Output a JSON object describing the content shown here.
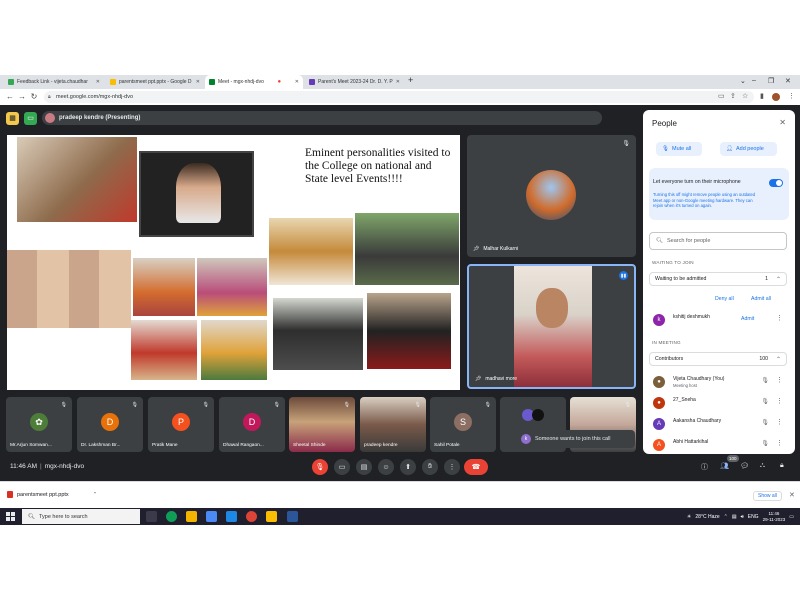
{
  "browser": {
    "tabs": [
      {
        "title": "Feedback Link - vijeta.chaudhar",
        "active": false
      },
      {
        "title": "parentsmeet ppt.pptx - Google D",
        "active": false
      },
      {
        "title": "Meet - mgx-nhdj-dvo",
        "active": true
      },
      {
        "title": "Parent's Meet 2023-24 Dr. D. Y. P",
        "active": false
      }
    ],
    "url": "meet.google.com/mgx-nhdj-dvo"
  },
  "meet": {
    "presenter_label": "pradeep kendre (Presenting)",
    "slide": {
      "heading": "Eminent personalities visited to the College on national and State level Events!!!!"
    },
    "right_tiles": [
      {
        "name": "Malhar Kulkarni"
      },
      {
        "name": "madhavi more"
      }
    ],
    "bottom_tiles": [
      {
        "name": "Mr.Arjun Somwan...",
        "initial": "",
        "color": "#3c4043"
      },
      {
        "name": "Dr. Lakshman Br...",
        "initial": "D",
        "color": "#e8710a"
      },
      {
        "name": "Pratik Mane",
        "initial": "P",
        "color": "#f4511e"
      },
      {
        "name": "Dhawal Rangaon...",
        "initial": "D",
        "color": "#c2185b"
      },
      {
        "name": "Sheetal Shinde",
        "initial": "",
        "color": "#5d4037"
      },
      {
        "name": "pradeep kendre",
        "initial": "",
        "color": "#6d4c41"
      },
      {
        "name": "Sahil Potale",
        "initial": "S",
        "color": "#8d6e63"
      }
    ],
    "join_toast": "Someone wants to join this call",
    "time": "11:46 AM",
    "meeting_code": "mgx-nhdj-dvo",
    "participant_badge": "100"
  },
  "people": {
    "title": "People",
    "mute_all": "Mute all",
    "add_people": "Add people",
    "mic_title": "Let everyone turn on their microphone",
    "mic_desc": "Turning this off might remove people using an outdated Meet app or non-Google meeting hardware. They can rejoin when it's turned on again.",
    "search_placeholder": "Search for people",
    "waiting_section": "WAITING TO JOIN",
    "waiting_group": "Waiting to be admitted",
    "waiting_count": "1",
    "deny_all": "Deny all",
    "admit_all": "Admit all",
    "waiting_person": {
      "name": "kshitij deshmukh",
      "initial": "k",
      "color": "#8e24aa"
    },
    "admit": "Admit",
    "meeting_section": "IN MEETING",
    "contributors_label": "Contributors",
    "contributors_count": "100",
    "participants": [
      {
        "name": "Vijeta Chaudhary (You)",
        "sub": "Meeting host",
        "initial": "V",
        "color": "#7b5e3a"
      },
      {
        "name": "27_Sneha",
        "sub": "",
        "initial": "2",
        "color": "#bf360c"
      },
      {
        "name": "Aakansha Chaudhary",
        "sub": "",
        "initial": "A",
        "color": "#673ab7"
      },
      {
        "name": "Abhi Hattarkihal",
        "sub": "",
        "initial": "A",
        "color": "#f4511e"
      }
    ]
  },
  "downloads": {
    "file": "parentsmeet ppt.pptx",
    "show_all": "Show all"
  },
  "taskbar": {
    "search": "Type here to search",
    "weather": "28°C  Haze",
    "lang": "ENG",
    "time": "11:46",
    "date": "29-11-2023"
  }
}
